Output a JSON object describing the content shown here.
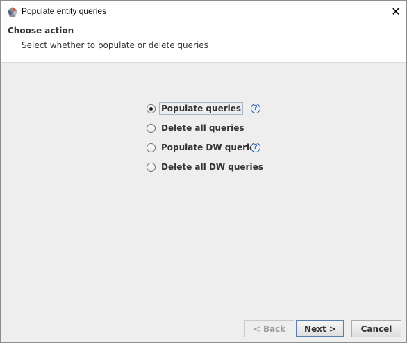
{
  "window": {
    "title": "Populate entity queries",
    "close_glyph": "✕"
  },
  "header": {
    "title": "Choose action",
    "subtitle": "Select whether to populate or delete queries"
  },
  "options": [
    {
      "label": "Populate queries",
      "selected": true,
      "has_help": true
    },
    {
      "label": "Delete all queries",
      "selected": false,
      "has_help": false
    },
    {
      "label": "Populate DW queries",
      "selected": false,
      "has_help": true
    },
    {
      "label": "Delete all DW queries",
      "selected": false,
      "has_help": false
    }
  ],
  "help_glyph": "?",
  "buttons": {
    "back_label": "< Back",
    "next_label": "Next >",
    "cancel_label": "Cancel"
  },
  "icons": {
    "app": "app-logo-icon",
    "help": "help-icon",
    "close": "close-icon"
  }
}
